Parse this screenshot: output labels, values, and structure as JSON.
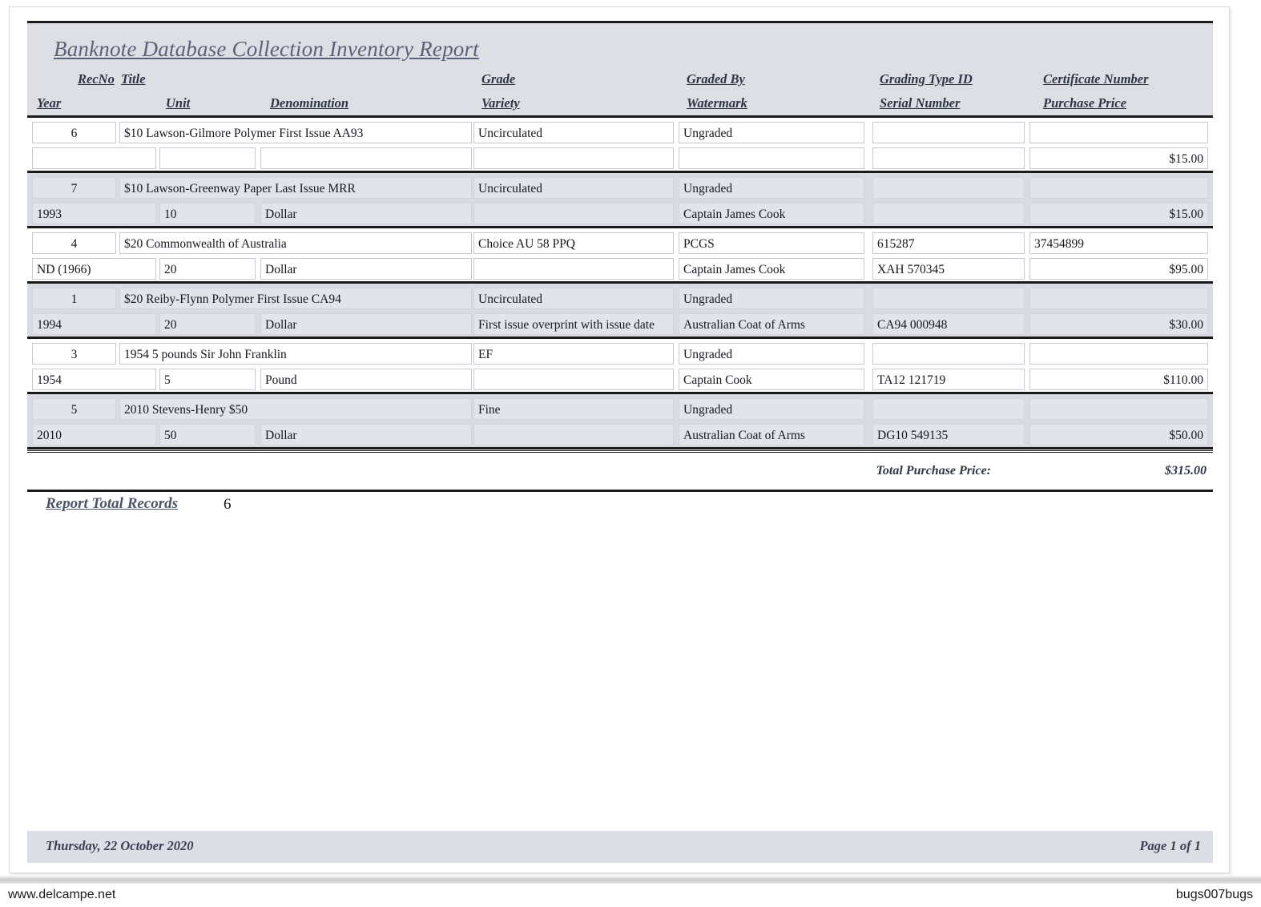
{
  "report": {
    "title": "Banknote Database Collection Inventory Report",
    "column_headers_row1": {
      "recno": "RecNo",
      "title": "Title",
      "grade": "Grade",
      "graded_by": "Graded By",
      "grading_type_id": "Grading Type ID",
      "certificate_number": "Certificate Number"
    },
    "column_headers_row2": {
      "year": "Year",
      "unit": "Unit",
      "denomination": "Denomination",
      "variety": "Variety",
      "watermark": "Watermark",
      "serial_number": "Serial Number",
      "purchase_price": "Purchase Price"
    },
    "records": [
      {
        "recno": "6",
        "title": "$10 Lawson-Gilmore Polymer First Issue AA93",
        "grade": "Uncirculated",
        "graded_by": "Ungraded",
        "grading_type_id": "",
        "certificate_number": "",
        "year": "",
        "unit": "",
        "denomination": "",
        "variety": "",
        "watermark": "",
        "serial_number": "",
        "purchase_price": "$15.00",
        "shaded": false
      },
      {
        "recno": "7",
        "title": "$10 Lawson-Greenway Paper Last Issue MRR",
        "grade": "Uncirculated",
        "graded_by": "Ungraded",
        "grading_type_id": "",
        "certificate_number": "",
        "year": "1993",
        "unit": "10",
        "denomination": "Dollar",
        "variety": "",
        "watermark": "Captain James Cook",
        "serial_number": "",
        "purchase_price": "$15.00",
        "shaded": true
      },
      {
        "recno": "4",
        "title": "$20 Commonwealth of Australia",
        "grade": "Choice AU 58 PPQ",
        "graded_by": "PCGS",
        "grading_type_id": "615287",
        "certificate_number": "37454899",
        "year": "ND (1966)",
        "unit": "20",
        "denomination": "Dollar",
        "variety": "",
        "watermark": "Captain James Cook",
        "serial_number": "XAH 570345",
        "purchase_price": "$95.00",
        "shaded": false
      },
      {
        "recno": "1",
        "title": "$20 Reiby-Flynn Polymer First Issue CA94",
        "grade": "Uncirculated",
        "graded_by": "Ungraded",
        "grading_type_id": "",
        "certificate_number": "",
        "year": "1994",
        "unit": "20",
        "denomination": "Dollar",
        "variety": "First issue overprint with issue date",
        "watermark": "Australian Coat of Arms",
        "serial_number": "CA94 000948",
        "purchase_price": "$30.00",
        "shaded": true
      },
      {
        "recno": "3",
        "title": "1954 5 pounds Sir John Franklin",
        "grade": "EF",
        "graded_by": "Ungraded",
        "grading_type_id": "",
        "certificate_number": "",
        "year": "1954",
        "unit": "5",
        "denomination": "Pound",
        "variety": "",
        "watermark": "Captain Cook",
        "serial_number": "TA12 121719",
        "purchase_price": "$110.00",
        "shaded": false
      },
      {
        "recno": "5",
        "title": "2010 Stevens-Henry $50",
        "grade": "Fine",
        "graded_by": "Ungraded",
        "grading_type_id": "",
        "certificate_number": "",
        "year": "2010",
        "unit": "50",
        "denomination": "Dollar",
        "variety": "",
        "watermark": "Australian Coat of Arms",
        "serial_number": "DG10 549135",
        "purchase_price": "$50.00",
        "shaded": true
      }
    ],
    "total_purchase_price_label": "Total Purchase Price:",
    "total_purchase_price_value": "$315.00",
    "report_total_records_label": "Report Total Records",
    "report_total_records_value": "6",
    "footer_date": "Thursday, 22 October 2020",
    "footer_page": "Page 1 of 1"
  },
  "watermarks": {
    "left": "www.delcampe.net",
    "right": "bugs007bugs"
  },
  "colors": {
    "header_band": "#dedfe5",
    "shaded_row": "#d9dbe3",
    "shaded_cell": "#e3e4ea",
    "title_text": "#5a6277",
    "header_text": "#2e3545",
    "rule": "#1a1a1a"
  }
}
